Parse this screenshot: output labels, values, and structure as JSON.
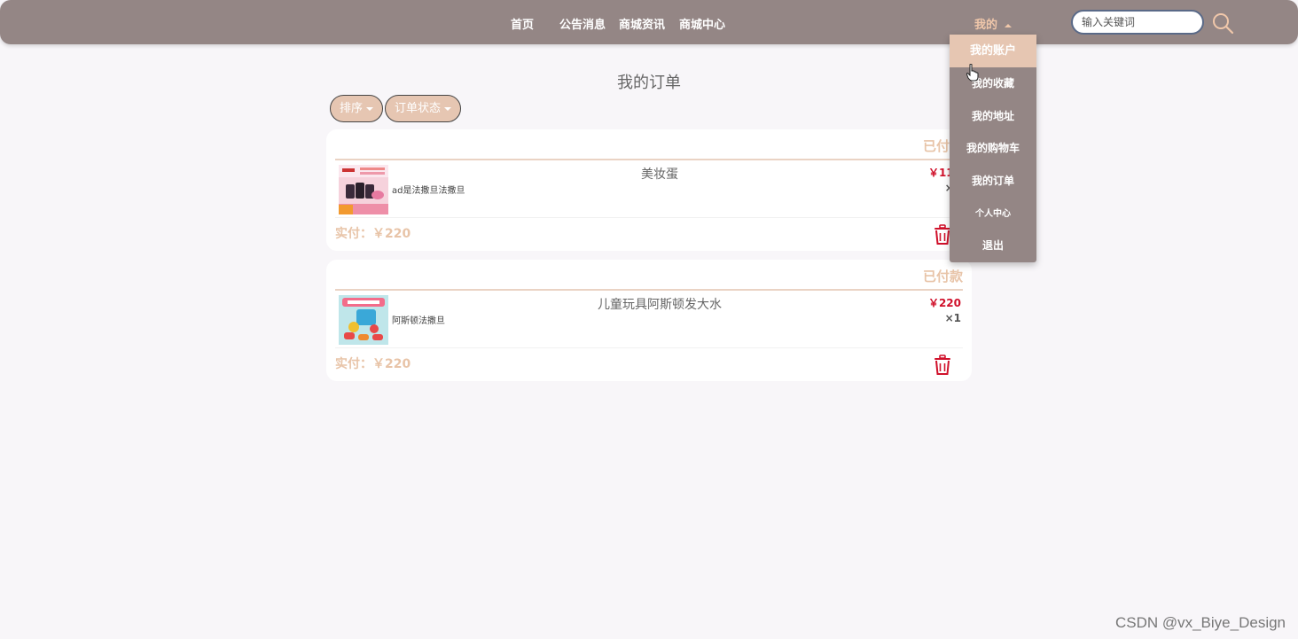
{
  "nav": {
    "items": [
      {
        "label": "首页"
      },
      {
        "label": "公告消息"
      },
      {
        "label": "商城资讯"
      },
      {
        "label": "商城中心"
      }
    ],
    "user_menu_label": "我的",
    "search_placeholder": "输入关键词"
  },
  "dropdown": {
    "items": [
      {
        "label": "我的账户"
      },
      {
        "label": "我的收藏"
      },
      {
        "label": "我的地址"
      },
      {
        "label": "我的购物车"
      },
      {
        "label": "我的订单"
      },
      {
        "label": "个人中心"
      },
      {
        "label": "退出"
      }
    ]
  },
  "page": {
    "title": "我的订单",
    "sort_label": "排序",
    "status_filter_label": "订单状态"
  },
  "orders": [
    {
      "status": "已付款",
      "product_name": "美妆蛋",
      "description": "ad是法撒旦法撒旦",
      "price": "￥110",
      "quantity": "×2",
      "paid_label": "实付：",
      "paid_amount": "￥220"
    },
    {
      "status": "已付款",
      "product_name": "儿童玩具阿斯顿发大水",
      "description": "阿斯顿法撒旦",
      "price": "￥220",
      "quantity": "×1",
      "paid_label": "实付：",
      "paid_amount": "￥220"
    }
  ],
  "colors": {
    "header_bg": "#948685",
    "accent_beige": "#e6c6b2",
    "price_red": "#d0112b"
  },
  "watermark": "CSDN @vx_Biye_Design"
}
